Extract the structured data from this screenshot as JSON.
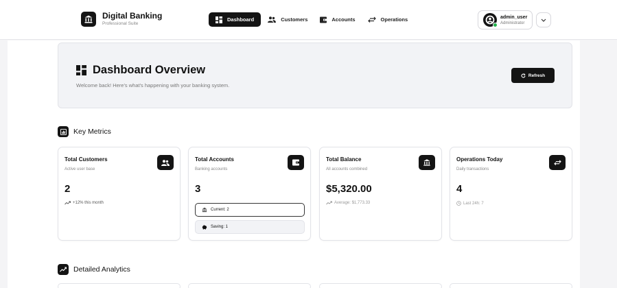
{
  "brand": {
    "title": "Digital Banking",
    "subtitle": "Professional Suite",
    "logo_icon": "bank-icon"
  },
  "nav": {
    "items": [
      {
        "label": "Dashboard",
        "icon": "dashboard-icon",
        "active": true
      },
      {
        "label": "Customers",
        "icon": "users-icon",
        "active": false
      },
      {
        "label": "Accounts",
        "icon": "wallet-icon",
        "active": false
      },
      {
        "label": "Operations",
        "icon": "transfer-icon",
        "active": false
      }
    ]
  },
  "user": {
    "name": "admin_user",
    "role": "Administrator",
    "status_color": "#22b14c",
    "menu_icon": "chevron-down-icon"
  },
  "overview": {
    "title": "Dashboard Overview",
    "subtitle": "Welcome back! Here's what's happening with your banking system.",
    "refresh_label": "Refresh"
  },
  "sections": {
    "key_metrics": "Key Metrics",
    "detailed_analytics": "Detailed Analytics"
  },
  "metrics": [
    {
      "title": "Total Customers",
      "subtitle": "Active user base",
      "value": "2",
      "note": "+12% this month",
      "icon": "users-icon"
    },
    {
      "title": "Total Accounts",
      "subtitle": "Banking accounts",
      "value": "3",
      "current": "Current: 2",
      "saving": "Saving: 1",
      "icon": "wallet-icon"
    },
    {
      "title": "Total Balance",
      "subtitle": "All accounts combined",
      "value": "$5,320.00",
      "note": "Average: $1,773.33",
      "icon": "bank-icon"
    },
    {
      "title": "Operations Today",
      "subtitle": "Daily transactions",
      "value": "4",
      "note": "Last 24h: 7",
      "icon": "transfer-icon"
    }
  ],
  "colors": {
    "accent": "#141414",
    "background": "#f4f4f6",
    "panel": "#f2f3f6"
  }
}
